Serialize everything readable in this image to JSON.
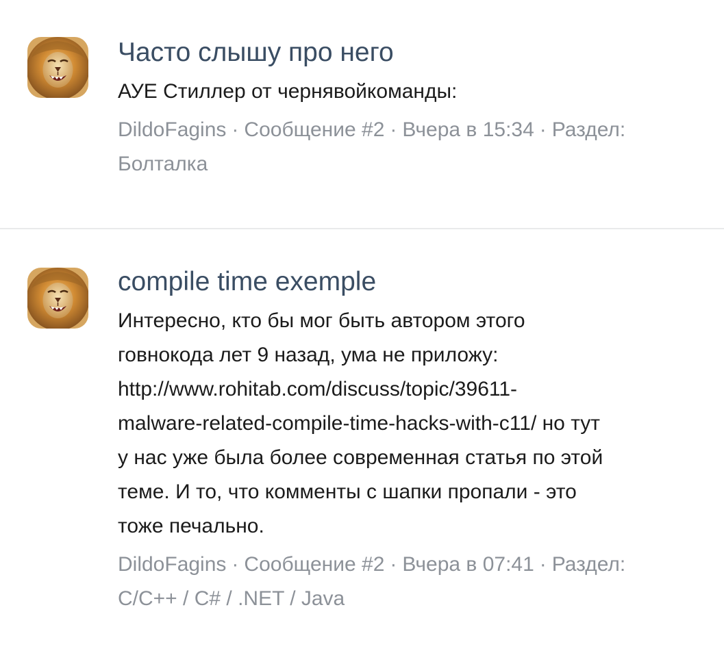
{
  "posts": [
    {
      "title": "Часто слышу про него",
      "body": "АУЕ Стиллер от чернявойкоманды:",
      "author": "DildoFagins",
      "message": "Сообщение #2",
      "time": "Вчера в 15:34",
      "section_label": "Раздел:",
      "section": "Болталка",
      "avatar_icon": "lion-avatar-icon"
    },
    {
      "title": "compile time exemple",
      "body_lines": [
        "Интересно, кто бы мог быть автором этого",
        "говнокода лет 9 назад, ума не приложу:",
        "http://www.rohitab.com/discuss/topic/39611-",
        "malware-related-compile-time-hacks-with-c11/ но тут",
        "у нас уже была более современная статья по этой",
        "теме. И то, что комменты с шапки пропали - это",
        "тоже печально."
      ],
      "author": "DildoFagins",
      "message": "Сообщение #2",
      "time": "Вчера в 07:41",
      "section_label": "Раздел:",
      "section": "C/C++ / C# / .NET / Java",
      "avatar_icon": "lion-avatar-icon"
    }
  ],
  "meta_separator": "·",
  "colors": {
    "title": "#3a4d63",
    "body": "#1b1b1b",
    "meta": "#8c9198",
    "divider": "#e9eaeb"
  }
}
